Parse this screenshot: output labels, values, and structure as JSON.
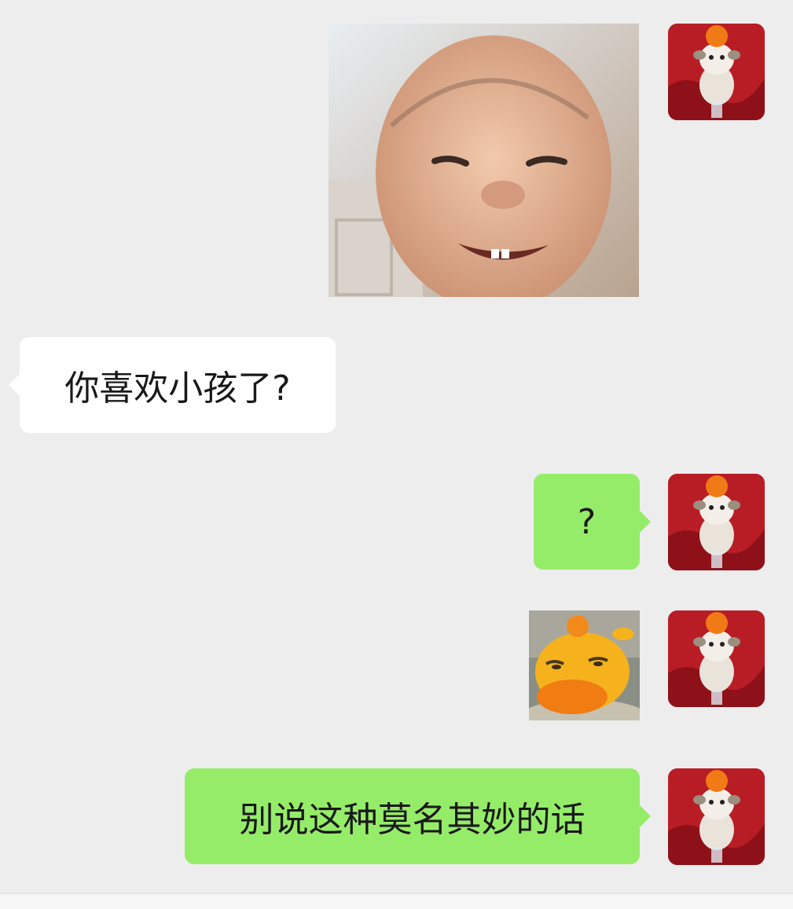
{
  "messages": [
    {
      "side": "right",
      "type": "image",
      "image": "baby-photo"
    },
    {
      "side": "left",
      "type": "text",
      "text": "你喜欢小孩了?"
    },
    {
      "side": "right",
      "type": "text",
      "text": "?"
    },
    {
      "side": "right",
      "type": "image",
      "image": "orange-duck-sticker"
    },
    {
      "side": "right",
      "type": "text",
      "text": "别说这种莫名其妙的话"
    }
  ],
  "colors": {
    "background": "#ededed",
    "incoming_bubble": "#ffffff",
    "outgoing_bubble": "#95ec69",
    "text": "#191919"
  },
  "icons": [
    "sheep-with-orange-avatar"
  ]
}
